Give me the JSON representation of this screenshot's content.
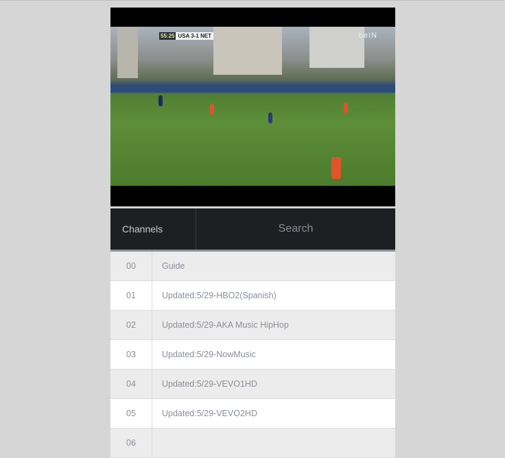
{
  "video": {
    "score_clock": "55:25",
    "score_text": "USA 3-1 NET",
    "broadcaster": "beIN"
  },
  "header": {
    "channels_label": "Channels",
    "search_label": "Search"
  },
  "channels": [
    {
      "number": "00",
      "name": "Guide"
    },
    {
      "number": "01",
      "name": "Updated:5/29-HBO2(Spanish)"
    },
    {
      "number": "02",
      "name": "Updated:5/29-AKA Music HipHop"
    },
    {
      "number": "03",
      "name": "Updated:5/29-NowMusic"
    },
    {
      "number": "04",
      "name": "Updated:5/29-VEVO1HD"
    },
    {
      "number": "05",
      "name": "Updated:5/29-VEVO2HD"
    },
    {
      "number": "06",
      "name": ""
    }
  ]
}
